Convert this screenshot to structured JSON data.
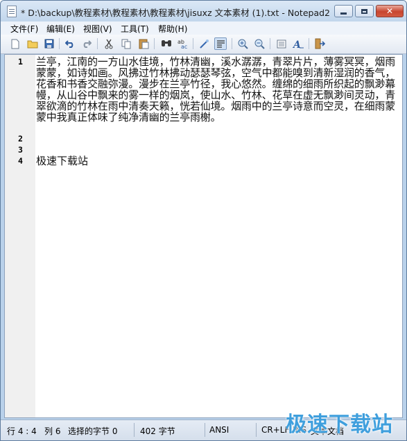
{
  "window": {
    "title": "* D:\\backup\\教程素材\\教程素材\\教程素材\\jisuxz 文本素材 (1).txt - Notepad2",
    "close_glyph": "✕"
  },
  "menu": {
    "items": [
      "文件(F)",
      "编辑(E)",
      "视图(V)",
      "工具(T)",
      "帮助(H)"
    ]
  },
  "toolbar": {
    "buttons": [
      {
        "icon": "new-file-icon",
        "glyph": "🗋"
      },
      {
        "icon": "open-folder-icon",
        "glyph": "📂"
      },
      {
        "icon": "save-icon",
        "glyph": "💾"
      },
      {
        "icon": "undo-icon",
        "glyph": "↶"
      },
      {
        "icon": "redo-icon",
        "glyph": "↷"
      },
      {
        "icon": "cut-icon",
        "glyph": "✂"
      },
      {
        "icon": "copy-icon",
        "glyph": "⧉"
      },
      {
        "icon": "paste-icon",
        "glyph": "📋"
      },
      {
        "icon": "find-icon",
        "glyph": "🔍"
      },
      {
        "icon": "replace-icon",
        "glyph": "ab"
      },
      {
        "icon": "word-wrap-icon",
        "glyph": "↵"
      },
      {
        "icon": "wrap-toggle-icon",
        "glyph": "≡"
      },
      {
        "icon": "zoom-in-icon",
        "glyph": "⊕"
      },
      {
        "icon": "zoom-out-icon",
        "glyph": "⊖"
      },
      {
        "icon": "scheme-icon",
        "glyph": "▤"
      },
      {
        "icon": "font-icon",
        "glyph": "A"
      },
      {
        "icon": "exit-icon",
        "glyph": "⇥"
      }
    ]
  },
  "editor": {
    "line_numbers": [
      "1",
      "2",
      "3",
      "4"
    ],
    "lines": [
      "兰亭，江南的一方山水佳境，竹林清幽，溪水潺潺，青翠片片，薄雾冥冥，烟雨蒙蒙，如诗如画。风拂过竹林拂动瑟瑟琴弦，空气中都能嗅到清新湿润的香气，花香和书香交融弥漫。漫步在兰亭竹径，我心悠然。缠绵的细雨所织起的飘渺幕幔，从山谷中飘来的雾一样的烟岚，使山水、竹林、花草在虚无飘渺间灵动，青翠欲滴的竹林在雨中清奏天籁，恍若仙境。烟雨中的兰亭诗意而空灵，在细雨蒙蒙中我真正体味了纯净清幽的兰亭雨榭。",
      "",
      "",
      "极速下载站"
    ]
  },
  "status": {
    "position": "行 4 : 4",
    "column": "列 6",
    "selected": "选择的字节 0",
    "size": "402 字节",
    "encoding": "ANSI",
    "eol": "CR+LF",
    "mode": "INS",
    "scheme": "文本文档"
  },
  "watermark": "极速下载站"
}
